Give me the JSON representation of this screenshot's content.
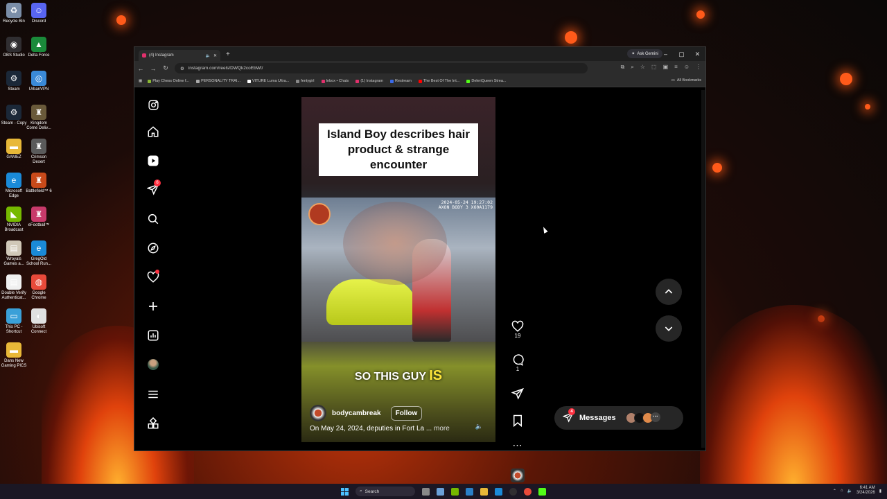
{
  "desktop": {
    "icons": [
      {
        "label": "Recycle Bin",
        "icon": "recycle-bin-icon",
        "color": "#7b8ea8"
      },
      {
        "label": "Discord",
        "icon": "discord-icon",
        "color": "#5865f2"
      },
      {
        "label": "OBS Studio",
        "icon": "obs-icon",
        "color": "#302e31"
      },
      {
        "label": "Delta Force",
        "icon": "delta-force-icon",
        "color": "#1a8a3a"
      },
      {
        "label": "Steam",
        "icon": "steam-icon",
        "color": "#1b2838"
      },
      {
        "label": "UrbanVPN",
        "icon": "vpn-icon",
        "color": "#3a8ad8"
      },
      {
        "label": "Steam - Copy",
        "icon": "steam-icon",
        "color": "#1b2838"
      },
      {
        "label": "Kingdom Come Deliv...",
        "icon": "game-icon",
        "color": "#6a5a3a"
      },
      {
        "label": "GAMEZ",
        "icon": "folder-icon",
        "color": "#e8b838"
      },
      {
        "label": "Crimson Desert",
        "icon": "game-icon",
        "color": "#5a5a5a"
      },
      {
        "label": "Microsoft Edge",
        "icon": "edge-icon",
        "color": "#1a8ad8"
      },
      {
        "label": "Battlefield™ 6",
        "icon": "game-icon",
        "color": "#c84a1a"
      },
      {
        "label": "NVIDIA Broadcast",
        "icon": "nvidia-icon",
        "color": "#76b900"
      },
      {
        "label": "eFootball™",
        "icon": "game-icon",
        "color": "#c83a6a"
      },
      {
        "label": "Wroyals Games a...",
        "icon": "file-icon",
        "color": "#d0c8b8"
      },
      {
        "label": "GregOld School Run...",
        "icon": "edge-icon",
        "color": "#1a8ad8"
      },
      {
        "label": "Double Verify Authenticat...",
        "icon": "file-icon",
        "color": "#f0f0f0"
      },
      {
        "label": "Google Chrome",
        "icon": "chrome-icon",
        "color": "#e84a3a"
      },
      {
        "label": "This PC - Shortcut",
        "icon": "pc-icon",
        "color": "#3aa0d8"
      },
      {
        "label": "Ubisoft Connect",
        "icon": "ubisoft-icon",
        "color": "#e0e0e0"
      },
      {
        "label": "Dans New Gaming PICS",
        "icon": "folder-icon",
        "color": "#e8b838"
      }
    ]
  },
  "browser": {
    "tab_title": "(4) Instagram",
    "ask_gemini": "Ask Gemini",
    "url": "instagram.com/reels/DWQk2coEbWt/",
    "bookmarks": [
      {
        "label": "Play Chess Online f...",
        "color": "#8ab834"
      },
      {
        "label": "PERSONALITY TRAI...",
        "color": "#aaaaaa"
      },
      {
        "label": "VITURE Luma Ultra...",
        "color": "#ffffff"
      },
      {
        "label": "fentygirl",
        "color": "#888888"
      },
      {
        "label": "Inbox • Chats",
        "color": "#e1306c"
      },
      {
        "label": "(1) Instagram",
        "color": "#e1306c"
      },
      {
        "label": "Restream",
        "color": "#3a6ae8"
      },
      {
        "label": "The Best Of The Int...",
        "color": "#ff0000"
      },
      {
        "label": "DeleriQueen Strea...",
        "color": "#53fc18"
      }
    ],
    "all_bookmarks": "All Bookmarks"
  },
  "instagram": {
    "nav_badge_count": "6",
    "reel": {
      "title": "Island Boy describes hair product & strange encounter",
      "timestamp_line1": "2024-05-24 19:27:02",
      "timestamp_line2": "AXON BODY 3 X60A1179",
      "subtitle_main": "SO THIS GUY",
      "subtitle_highlight": "IS",
      "username": "bodycambreak",
      "follow_label": "Follow",
      "description": "On May 24, 2024, deputies in Fort La ...",
      "more_label": "more"
    },
    "actions": {
      "likes": "19",
      "comments": "1"
    },
    "messages": {
      "label": "Messages",
      "badge": "4"
    }
  },
  "taskbar": {
    "search_label": "Search",
    "time": "6:41 AM",
    "date": "3/24/2026"
  }
}
